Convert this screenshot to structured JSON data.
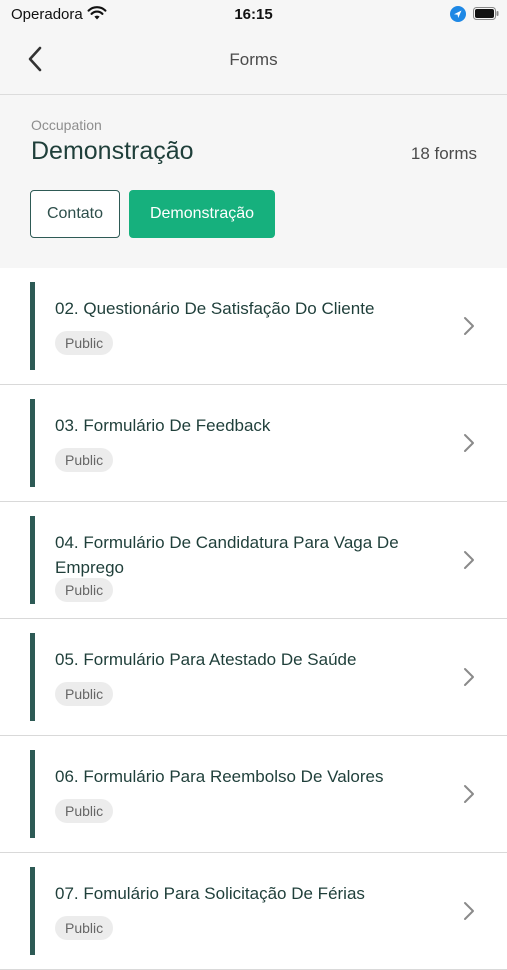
{
  "status_bar": {
    "carrier": "Operadora",
    "time": "16:15"
  },
  "nav": {
    "title": "Forms"
  },
  "occupation": {
    "label": "Occupation",
    "name": "Demonstração",
    "count": "18 forms"
  },
  "filters": [
    {
      "label": "Contato",
      "active": false
    },
    {
      "label": "Demonstração",
      "active": true
    }
  ],
  "forms": [
    {
      "title": "02. Questionário De Satisfação Do Cliente",
      "badge": "Public"
    },
    {
      "title": "03. Formulário De Feedback",
      "badge": "Public"
    },
    {
      "title": "04. Formulário De Candidatura Para Vaga De Emprego",
      "badge": "Public"
    },
    {
      "title": "05. Formulário Para Atestado De Saúde",
      "badge": "Public"
    },
    {
      "title": "06. Formulário Para Reembolso De Valores",
      "badge": "Public"
    },
    {
      "title": "07. Fomulário Para Solicitação De Férias",
      "badge": "Public"
    }
  ],
  "colors": {
    "accent": "#16b07d",
    "dark": "#2d5a55",
    "text": "#1f3f3a"
  }
}
